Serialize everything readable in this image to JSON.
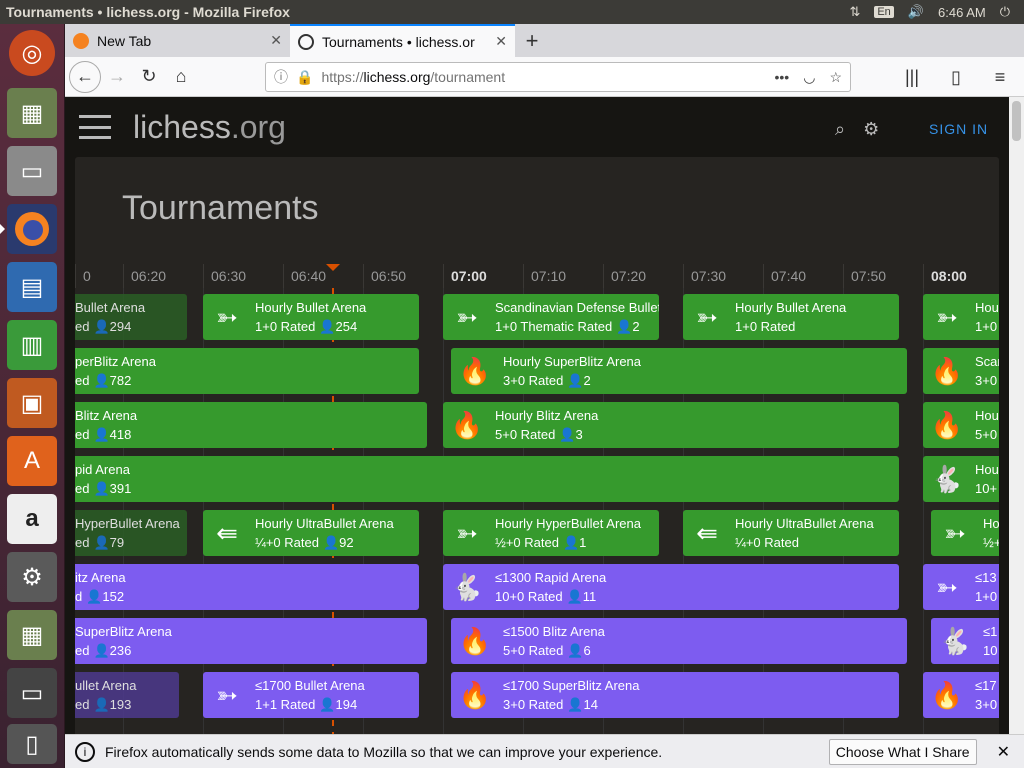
{
  "system": {
    "window_title": "Tournaments • lichess.org - Mozilla Firefox",
    "lang": "En",
    "clock": "6:46 AM"
  },
  "launcher": {
    "items": [
      "ubuntu-icon",
      "disk-installer-icon",
      "file-manager-icon",
      "firefox-icon",
      "writer-icon",
      "calc-icon",
      "impress-icon",
      "software-center-icon",
      "amazon-icon",
      "settings-icon",
      "disk-installer-icon",
      "floppy-icon",
      "trash-icon"
    ]
  },
  "browser": {
    "tabs": [
      {
        "label": "New Tab"
      },
      {
        "label": "Tournaments • lichess.or"
      }
    ],
    "url": {
      "scheme": "https://",
      "host": "lichess.org",
      "path": "/tournament"
    }
  },
  "site": {
    "logo_main": "lichess",
    "logo_tld": ".org",
    "signin": "SIGN IN",
    "page_title": "Tournaments"
  },
  "timeline": {
    "ticks": [
      "0",
      "06:20",
      "06:30",
      "06:40",
      "06:50",
      "07:00",
      "07:10",
      "07:20",
      "07:30",
      "07:40",
      "07:50",
      "08:00"
    ],
    "hour_ticks": [
      "07:00",
      "08:00"
    ],
    "now": "06:46"
  },
  "rows": [
    [
      {
        "name": "Bullet Arena",
        "meta": "ed",
        "players": "294",
        "color": "g",
        "finished": true,
        "icon": "bullet"
      },
      {
        "name": "Hourly Bullet Arena",
        "meta": "1+0 Rated",
        "players": "254",
        "color": "g",
        "icon": "bullet"
      },
      {
        "name": "Scandinavian Defense Bullet A",
        "meta": "1+0 Thematic Rated",
        "players": "2",
        "color": "g",
        "icon": "bullet"
      },
      {
        "name": "Hourly Bullet Arena",
        "meta": "1+0 Rated",
        "players": "",
        "color": "g",
        "icon": "bullet"
      },
      {
        "name": "Hou",
        "meta": "1+0",
        "players": "",
        "color": "g",
        "icon": "bullet"
      }
    ],
    [
      {
        "name": "perBlitz Arena",
        "meta": "ed",
        "players": "782",
        "color": "g",
        "icon": "fire"
      },
      {
        "name": "Hourly SuperBlitz Arena",
        "meta": "3+0 Rated",
        "players": "2",
        "color": "g",
        "icon": "fire"
      },
      {
        "name": "Scan",
        "meta": "3+0",
        "players": "",
        "color": "g",
        "icon": "fire"
      }
    ],
    [
      {
        "name": "Blitz Arena",
        "meta": "ed",
        "players": "418",
        "color": "g",
        "icon": "fire"
      },
      {
        "name": "Hourly Blitz Arena",
        "meta": "5+0 Rated",
        "players": "3",
        "color": "g",
        "icon": "fire"
      },
      {
        "name": "Hou",
        "meta": "5+0",
        "players": "",
        "color": "g",
        "icon": "fire"
      }
    ],
    [
      {
        "name": "pid Arena",
        "meta": "ed",
        "players": "391",
        "color": "g",
        "icon": "rabbit"
      },
      {
        "name": "Hou",
        "meta": "10+",
        "players": "",
        "color": "g",
        "icon": "rabbit"
      }
    ],
    [
      {
        "name": "HyperBullet Arena",
        "meta": "ed",
        "players": "79",
        "color": "g",
        "finished": true,
        "icon": "bullet"
      },
      {
        "name": "Hourly UltraBullet Arena",
        "meta": "¼+0 Rated",
        "players": "92",
        "color": "g",
        "icon": "ultra"
      },
      {
        "name": "Hourly HyperBullet Arena",
        "meta": "½+0 Rated",
        "players": "1",
        "color": "g",
        "icon": "bullet"
      },
      {
        "name": "Hourly UltraBullet Arena",
        "meta": "¼+0 Rated",
        "players": "",
        "color": "g",
        "icon": "ultra"
      },
      {
        "name": "Ho",
        "meta": "½+",
        "players": "",
        "color": "g",
        "icon": "bullet"
      }
    ],
    [
      {
        "name": "itz Arena",
        "meta": "d",
        "players": "152",
        "color": "p",
        "icon": "fire"
      },
      {
        "name": "≤1300 Rapid Arena",
        "meta": "10+0 Rated",
        "players": "11",
        "color": "p",
        "icon": "rabbit"
      },
      {
        "name": "≤13",
        "meta": "1+0",
        "players": "",
        "color": "p",
        "icon": "bullet"
      }
    ],
    [
      {
        "name": "SuperBlitz Arena",
        "meta": "ed",
        "players": "236",
        "color": "p",
        "icon": "fire"
      },
      {
        "name": "≤1500 Blitz Arena",
        "meta": "5+0 Rated",
        "players": "6",
        "color": "p",
        "icon": "fire"
      },
      {
        "name": "≤1",
        "meta": "10",
        "players": "",
        "color": "p",
        "icon": "rabbit"
      }
    ],
    [
      {
        "name": "ullet Arena",
        "meta": "ed",
        "players": "193",
        "color": "p",
        "finished": true,
        "icon": "bullet"
      },
      {
        "name": "≤1700 Bullet Arena",
        "meta": "1+1 Rated",
        "players": "194",
        "color": "p",
        "icon": "bullet"
      },
      {
        "name": "≤1700 SuperBlitz Arena",
        "meta": "3+0 Rated",
        "players": "14",
        "color": "p",
        "icon": "fire"
      },
      {
        "name": "≤17",
        "meta": "3+0",
        "players": "",
        "color": "p",
        "icon": "fire"
      }
    ]
  ],
  "notification": {
    "text": "Firefox automatically sends some data to Mozilla so that we can improve your experience.",
    "button": "Choose What I Share"
  }
}
